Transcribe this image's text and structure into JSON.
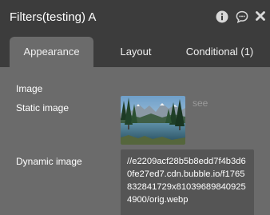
{
  "header": {
    "title": "Filters(testing) A",
    "icons": [
      "info-icon",
      "chat-icon",
      "close-icon"
    ]
  },
  "tabs": [
    {
      "label": "Appearance",
      "active": true
    },
    {
      "label": "Layout",
      "active": false
    },
    {
      "label": "Conditional (1)",
      "active": false
    }
  ],
  "properties": {
    "image_label": "Image",
    "static_image_label": "Static image",
    "see_link": "see",
    "dynamic_image_label": "Dynamic image",
    "dynamic_image_value": "//e2209acf28b5b8edd7f4b3d60fe27ed7.cdn.bubble.io/f1765832841729x810396898409254900/orig.webp"
  },
  "colors": {
    "panel": "#6b6b6b",
    "header": "#3c3c3c",
    "field": "#555555",
    "link": "#9a9a9a"
  }
}
